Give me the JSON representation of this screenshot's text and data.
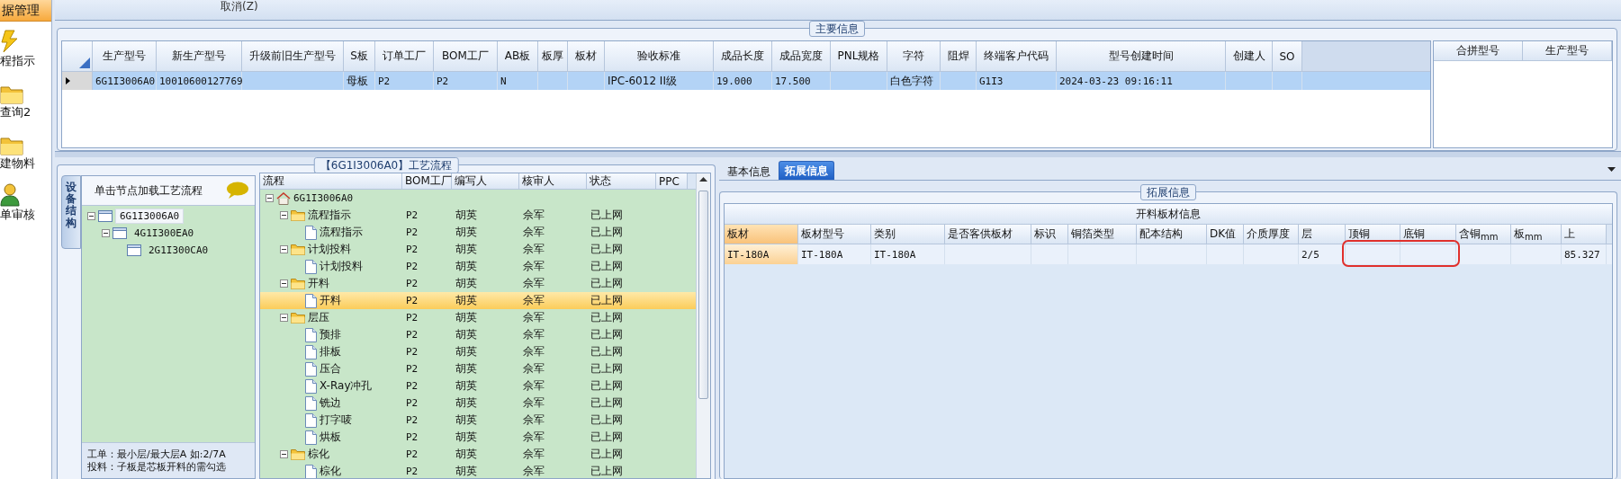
{
  "sidebar": {
    "header": "据管理",
    "items": [
      {
        "label": "程指示",
        "kind": "bolt"
      },
      {
        "label": "查询2",
        "kind": "folder"
      },
      {
        "label": "建物料",
        "kind": "folder"
      },
      {
        "label": "单审核",
        "kind": "user"
      }
    ]
  },
  "toolbar": {
    "cancel_button": "取消(Z)"
  },
  "main_info": {
    "title": "主要信息",
    "columns": [
      "生产型号",
      "新生产型号",
      "升级前旧生产型号",
      "S板",
      "订单工厂",
      "BOM工厂",
      "AB板",
      "板厚",
      "板材",
      "验收标准",
      "成品长度",
      "成品宽度",
      "PNL规格",
      "字符",
      "阻焊",
      "终端客户代码",
      "型号创建时间",
      "创建人",
      "SO"
    ],
    "rows": [
      {
        "selected": true,
        "cells": [
          "6G1I3006A0",
          "10010600127769",
          null,
          "母板",
          "P2",
          "P2",
          "N",
          null,
          null,
          "IPC-6012 II级",
          "19.000",
          "17.500",
          null,
          "白色字符",
          null,
          "G1I3",
          "2024-03-23 09:16:11",
          null,
          null
        ]
      }
    ]
  },
  "merge_grid": {
    "columns": [
      "合拼型号",
      "生产型号"
    ]
  },
  "process": {
    "title": "【6G1I3006A0】工艺流程",
    "side_tab": "设备结构",
    "structure": {
      "hint": "单击节点加载工艺流程",
      "tree": [
        {
          "label": "6G1I3006A0",
          "selected": true,
          "expanded": true,
          "children": [
            {
              "label": "4G1I300EA0",
              "selected": false,
              "expanded": true,
              "children": [
                {
                  "label": "2G1I300CA0",
                  "selected": false
                }
              ]
            }
          ]
        }
      ],
      "notes": [
        "工单：最小层/最大层A 如:2/7A",
        "投料：子板是芯板开料的需勾选"
      ]
    },
    "flow": {
      "columns": [
        "流程",
        "BOM工厂",
        "编写人",
        "核审人",
        "状态",
        "PPC"
      ],
      "tree": [
        {
          "label": "6G1I3006A0",
          "selected": false,
          "expanded": true,
          "cells": [
            null,
            null,
            null,
            null,
            null
          ],
          "children": [
            {
              "label": "流程指示",
              "selected": false,
              "expanded": true,
              "cells": [
                "P2",
                "胡英",
                "佘军",
                "已上网",
                null
              ],
              "children": [
                {
                  "label": "流程指示",
                  "selected": false,
                  "cells": [
                    "P2",
                    "胡英",
                    "佘军",
                    "已上网",
                    null
                  ]
                }
              ]
            },
            {
              "label": "计划投料",
              "selected": false,
              "expanded": true,
              "cells": [
                "P2",
                "胡英",
                "佘军",
                "已上网",
                null
              ],
              "children": [
                {
                  "label": "计划投料",
                  "selected": false,
                  "cells": [
                    "P2",
                    "胡英",
                    "佘军",
                    "已上网",
                    null
                  ]
                }
              ]
            },
            {
              "label": "开料",
              "selected": false,
              "expanded": true,
              "cells": [
                "P2",
                "胡英",
                "佘军",
                "已上网",
                null
              ],
              "children": [
                {
                  "label": "开料",
                  "selected": true,
                  "cells": [
                    "P2",
                    "胡英",
                    "佘军",
                    "已上网",
                    null
                  ]
                }
              ]
            },
            {
              "label": "层压",
              "selected": false,
              "expanded": true,
              "cells": [
                "P2",
                "胡英",
                "佘军",
                "已上网",
                null
              ],
              "children": [
                {
                  "label": "预排",
                  "selected": false,
                  "cells": [
                    "P2",
                    "胡英",
                    "佘军",
                    "已上网",
                    null
                  ]
                },
                {
                  "label": "排板",
                  "selected": false,
                  "cells": [
                    "P2",
                    "胡英",
                    "佘军",
                    "已上网",
                    null
                  ]
                },
                {
                  "label": "压合",
                  "selected": false,
                  "cells": [
                    "P2",
                    "胡英",
                    "佘军",
                    "已上网",
                    null
                  ]
                },
                {
                  "label": "X-Ray冲孔",
                  "selected": false,
                  "cells": [
                    "P2",
                    "胡英",
                    "佘军",
                    "已上网",
                    null
                  ]
                },
                {
                  "label": "铣边",
                  "selected": false,
                  "cells": [
                    "P2",
                    "胡英",
                    "佘军",
                    "已上网",
                    null
                  ]
                },
                {
                  "label": "打字唛",
                  "selected": false,
                  "cells": [
                    "P2",
                    "胡英",
                    "佘军",
                    "已上网",
                    null
                  ]
                },
                {
                  "label": "烘板",
                  "selected": false,
                  "cells": [
                    "P2",
                    "胡英",
                    "佘军",
                    "已上网",
                    null
                  ]
                }
              ]
            },
            {
              "label": "棕化",
              "selected": false,
              "expanded": true,
              "cells": [
                "P2",
                "胡英",
                "佘军",
                "已上网",
                null
              ],
              "children": [
                {
                  "label": "棕化",
                  "selected": false,
                  "cells": [
                    "P2",
                    "胡英",
                    "佘军",
                    "已上网",
                    null
                  ]
                }
              ]
            }
          ]
        }
      ]
    }
  },
  "detail": {
    "tabs": [
      {
        "label": "基本信息",
        "selected": false
      },
      {
        "label": "拓展信息",
        "selected": true
      }
    ],
    "group_title": "拓展信息",
    "table": {
      "title": "开料板材信息",
      "columns": [
        {
          "label": "板材",
          "selected": true,
          "annotated": false
        },
        {
          "label": "板材型号",
          "selected": false,
          "annotated": false
        },
        {
          "label": "类别",
          "selected": false,
          "annotated": false
        },
        {
          "label": "是否客供板材",
          "selected": false,
          "annotated": false
        },
        {
          "label": "标识",
          "selected": false,
          "annotated": false
        },
        {
          "label": "铜箔类型",
          "selected": false,
          "annotated": false
        },
        {
          "label": "配本结构",
          "selected": false,
          "annotated": false
        },
        {
          "label": "DK值",
          "selected": false,
          "annotated": false
        },
        {
          "label": "介质厚度",
          "selected": false,
          "annotated": false
        },
        {
          "label": "层",
          "selected": false,
          "annotated": false
        },
        {
          "label": "顶铜",
          "selected": false,
          "annotated": true
        },
        {
          "label": "底铜",
          "selected": false,
          "annotated": true
        },
        {
          "label": "含铜$_{mm}$",
          "selected": false,
          "annotated": false
        },
        {
          "label": "板$_{mm}$",
          "selected": false,
          "annotated": false
        },
        {
          "label": "上",
          "selected": false,
          "annotated": false
        }
      ],
      "rows": [
        {
          "cells": [
            "IT-180A",
            "IT-180A",
            "IT-180A",
            null,
            null,
            null,
            null,
            null,
            null,
            "2/5",
            null,
            null,
            null,
            null,
            "85.327"
          ]
        }
      ]
    }
  }
}
